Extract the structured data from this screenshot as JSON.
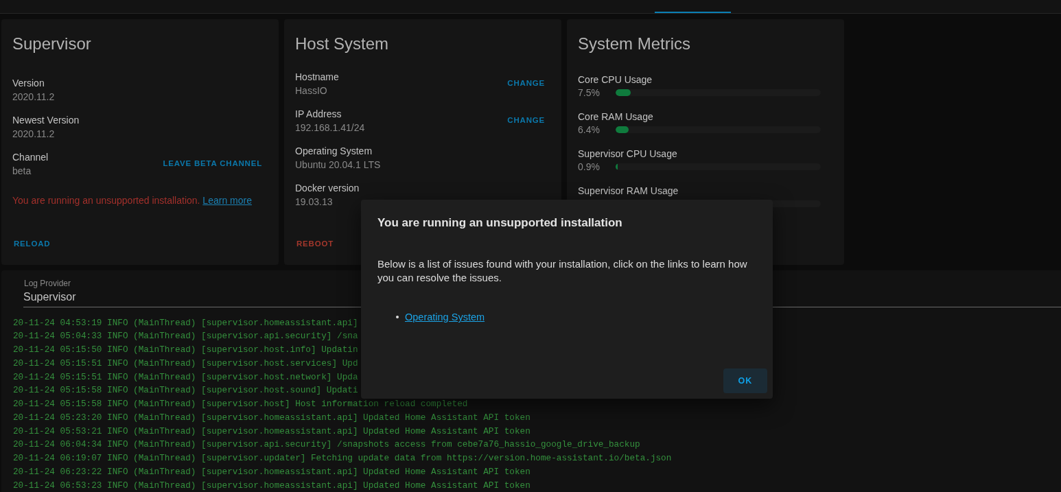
{
  "top_bar": {
    "selected_tab_underline": true
  },
  "cards": [
    {
      "title": "Supervisor",
      "rows": [
        {
          "label": "Version",
          "value": "2020.11.2"
        },
        {
          "label": "Newest Version",
          "value": "2020.11.2"
        },
        {
          "label": "Channel",
          "value": "beta",
          "action": "LEAVE BETA CHANNEL"
        }
      ],
      "warning": {
        "text": "You are running an unsupported installation.",
        "link": "Learn more"
      },
      "buttons": [
        {
          "label": "RELOAD",
          "kind": "primary"
        }
      ]
    },
    {
      "title": "Host System",
      "rows": [
        {
          "label": "Hostname",
          "value": "HassIO",
          "action": "CHANGE"
        },
        {
          "label": "IP Address",
          "value": "192.168.1.41/24",
          "action": "CHANGE"
        },
        {
          "label": "Operating System",
          "value": "Ubuntu 20.04.1 LTS"
        },
        {
          "label": "Docker version",
          "value": "19.03.13"
        }
      ],
      "buttons": [
        {
          "label": "REBOOT",
          "kind": "danger"
        }
      ]
    },
    {
      "title": "System Metrics",
      "metrics": [
        {
          "label": "Core CPU Usage",
          "value": "7.5%",
          "level": 0.075
        },
        {
          "label": "Core RAM Usage",
          "value": "6.4%",
          "level": 0.064
        },
        {
          "label": "Supervisor CPU Usage",
          "value": "0.9%",
          "level": 0.009
        },
        {
          "label": "Supervisor RAM Usage"
        }
      ]
    }
  ],
  "log_panel": {
    "provider_label": "Log Provider",
    "provider_value": "Supervisor",
    "lines": [
      "20-11-24 04:53:19 INFO (MainThread) [supervisor.homeassistant.api]",
      "20-11-24 05:04:33 INFO (MainThread) [supervisor.api.security] /sna",
      "20-11-24 05:15:50 INFO (MainThread) [supervisor.host.info] Updatin",
      "20-11-24 05:15:51 INFO (MainThread) [supervisor.host.services] Upd",
      "20-11-24 05:15:51 INFO (MainThread) [supervisor.host.network] Upda",
      "20-11-24 05:15:58 INFO (MainThread) [supervisor.host.sound] Updati",
      "20-11-24 05:15:58 INFO (MainThread) [supervisor.host] Host information reload completed",
      "20-11-24 05:23:20 INFO (MainThread) [supervisor.homeassistant.api] Updated Home Assistant API token",
      "20-11-24 05:53:21 INFO (MainThread) [supervisor.homeassistant.api] Updated Home Assistant API token",
      "20-11-24 06:04:34 INFO (MainThread) [supervisor.api.security] /snapshots access from cebe7a76_hassio_google_drive_backup",
      "20-11-24 06:19:07 INFO (MainThread) [supervisor.updater] Fetching update data from https://version.home-assistant.io/beta.json",
      "20-11-24 06:23:22 INFO (MainThread) [supervisor.homeassistant.api] Updated Home Assistant API token",
      "20-11-24 06:53:23 INFO (MainThread) [supervisor.homeassistant.api] Updated Home Assistant API token"
    ]
  },
  "dialog": {
    "title": "You are running an unsupported installation",
    "body": "Below is a list of issues found with your installation, click on the links to learn how you can resolve the issues.",
    "issues": [
      "Operating System"
    ],
    "button": "OK"
  }
}
